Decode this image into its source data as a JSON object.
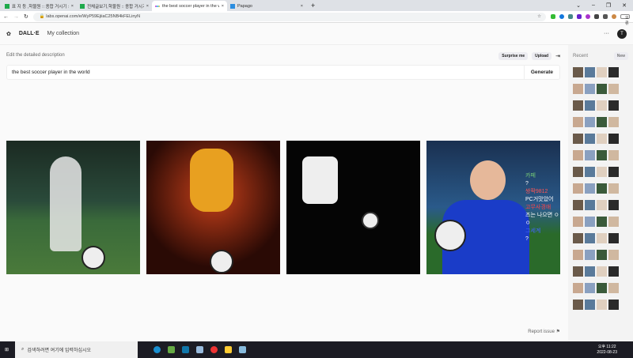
{
  "browser": {
    "tabs": [
      {
        "title": "표 지 등 ,학물원 :: 종합 거시기 ::"
      },
      {
        "title": "전체글보기,학물원 :: 종합 거시기"
      },
      {
        "title": "the best soccer player in the world"
      },
      {
        "title": "Papago"
      }
    ],
    "url": "labs.openai.com/e/WyP59EjiiaC25NB4kFELinyN",
    "profile_label": "오류"
  },
  "app": {
    "logo": "DALL·E",
    "nav_collection": "My collection",
    "avatar": "T",
    "label": "Edit the detailed description",
    "surprise": "Surprise me",
    "upload": "Upload",
    "prompt": "the best soccer player in the world",
    "generate": "Generate",
    "report": "Report issue"
  },
  "sidebar": {
    "recent": "Recent",
    "new": "New"
  },
  "taskbar": {
    "search_placeholder": "검색하려면 여기에 입력하십시오",
    "time": "오후 11:22",
    "date": "2022-08-23"
  },
  "image4_overlay": [
    "카페",
    "?",
    "쌍팍9812",
    "PC거맛았어",
    "고무사경애",
    "즈는 나으면 ㅇㅇ",
    "그세계",
    "?"
  ]
}
